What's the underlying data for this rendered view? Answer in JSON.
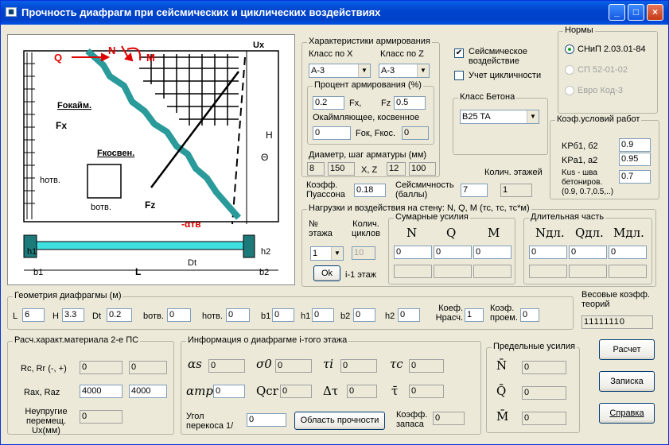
{
  "window": {
    "title": "Прочность диафрагм при сейсмических и циклических воздействиях"
  },
  "drawing": {
    "q": "Q",
    "n": "N",
    "m": "M",
    "ux": "Ux",
    "h": "H",
    "theta": "Θ",
    "fokaim": "Fокайм.",
    "fx": "Fx",
    "fkosven": "Fкосвен.",
    "hotv": "hотв.",
    "botv": "bотв.",
    "fz": "Fz",
    "alpha": "-αтв",
    "h1": "h1",
    "h2": "h2",
    "b1": "b1",
    "b2": "b2",
    "L": "L",
    "Dt": "Dt"
  },
  "reinforcement": {
    "title": "Характеристики армирования",
    "class_x_label": "Класс по X",
    "class_z_label": "Класс по Z",
    "class_x": "А-3",
    "class_z": "А-3",
    "percent_title": "Процент армирования  (%)",
    "fx_val": "0.2",
    "fx_label": "Fx,",
    "fz_label": "Fz",
    "fz_val": "0.5",
    "edge_label": "Окаймляющее,  косвенное",
    "fok_val": "0",
    "fok_label": "Fок, Fкос.",
    "fkos_val": "0",
    "diam_label": "Диаметр, шаг арматуры (мм)",
    "d1": "8",
    "s1": "150",
    "xz_label": "X, Z",
    "d2": "12",
    "s2": "100"
  },
  "options": {
    "seismic_label": "Сейсмическое воздействие",
    "cyclic_label": "Учет цикличности",
    "seismic_checked": true,
    "cyclic_checked": false
  },
  "norms": {
    "title": "Нормы",
    "n1": "СНиП 2.03.01-84",
    "n2": "СП 52-01-02",
    "n3": "Евро Код-3"
  },
  "concrete": {
    "title": "Класс Бетона",
    "value": "B25 TA"
  },
  "work_coef": {
    "title": "Коэф.условий работ",
    "kr_label": "KPб1, б2",
    "kr_val": "0.9",
    "kpa_label": "KPa1, a2",
    "kpa_val": "0.95",
    "kus_label": "Kus  - шва бетониров. (0.9, 0.7,0.5,..)",
    "kus_val": "0.7"
  },
  "misc": {
    "floors_label": "Колич. этажей",
    "floors_val": "1",
    "poisson_label": "Коэфф. Пуассона",
    "poisson_val": "0.18",
    "seism_label": "Сейсмичность (баллы)",
    "seism_val": "7"
  },
  "loads": {
    "title": "Нагрузки и воздействия на стену:  N,  Q,  M  (тс, тс,  тс*м)",
    "floor_label": "№ этажа",
    "cycles_label": "Колич. циклов",
    "floor_val": "1",
    "cycles_val": "10",
    "sum_title": "Сумарные усилия",
    "long_title": "Длительная часть",
    "n": "N",
    "q": "Q",
    "m": "M",
    "ndl": "Nдл.",
    "qdl": "Qдл.",
    "mdl": "Mдл.",
    "n_val": "0",
    "q_val": "0",
    "m_val": "0",
    "ndl_val": "0",
    "qdl_val": "0",
    "mdl_val": "0",
    "ok": "Ok",
    "prev_floor": "i-1 этаж"
  },
  "geometry": {
    "title": "Геометрия диафрагмы (м)",
    "L_label": "L",
    "L_val": "6",
    "H_label": "H",
    "H_val": "3.3",
    "Dt_label": "Dt",
    "Dt_val": "0.2",
    "botv_label": "bотв.",
    "botv_val": "0",
    "hotv_label": "hотв.",
    "hotv_val": "0",
    "b1_label": "b1",
    "b1_val": "0",
    "h1_label": "h1",
    "h1_val": "0",
    "b2_label": "b2",
    "b2_val": "0",
    "h2_label": "h2",
    "h2_val": "0",
    "kras_label": "Коеф. Нрасч.",
    "kras_val": "1",
    "kpro_label": "Коэф. проем.",
    "kpro_val": "0",
    "weights_label": "Весовые коэфф. теорий",
    "weights_val": "11111110"
  },
  "material": {
    "title": "Расч.характ.материала 2-е ПС",
    "rc_label": "Rc, Rr (-, +)",
    "rc_val": "0",
    "rr_val": "0",
    "rax_label": "Rax, Raz",
    "rax_val": "4000",
    "raz_val": "4000",
    "ux_label": "Неупругие перемещ. Ux(мм)",
    "ux_val": "0"
  },
  "info": {
    "title": "Информация  о диафрагме  i-того этажа",
    "as_label": "αs",
    "as_val": "0",
    "s0_label": "σ0",
    "s0_val": "0",
    "ti_label": "τi",
    "ti_val": "0",
    "tc_label": "τc",
    "tc_val": "0",
    "atr_label": "αтр",
    "atr_val": "0",
    "qcr_label": "Qcr",
    "qcr_val": "0",
    "dt_label": "Δτ",
    "dt_val": "0",
    "tbar_label": "τ̄",
    "tbar_val": "0",
    "angle_label": "Угол перекоса 1/",
    "angle_val": "0",
    "strength_btn": "Область прочности",
    "reserve_label": "Коэфф. запаса",
    "reserve_val": "0"
  },
  "limits": {
    "title": "Предельные усилия",
    "n": "N̄",
    "q": "Q̄",
    "m": "M̄",
    "n_val": "0",
    "q_val": "0",
    "m_val": "0"
  },
  "buttons": {
    "calc": "Расчет",
    "note": "Записка",
    "help": "Справка"
  },
  "colors": {
    "titlebar": "#0044cc",
    "wall_diag": "#2a9a9a",
    "arrow": "#e00000",
    "slab": "#40e0e0"
  }
}
